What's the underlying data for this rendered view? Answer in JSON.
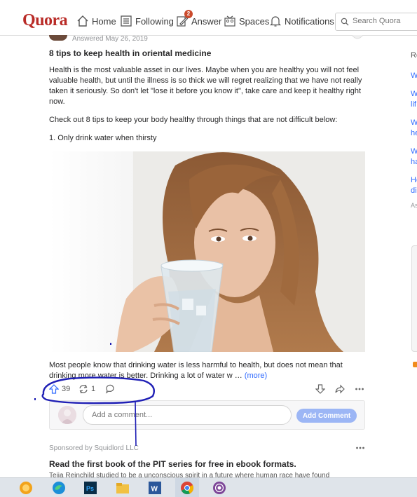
{
  "header": {
    "logo": "Quora",
    "nav": {
      "home": "Home",
      "following": "Following",
      "answer": "Answer",
      "answer_badge": "2",
      "spaces": "Spaces",
      "notifications": "Notifications"
    },
    "search_placeholder": "Search Quora"
  },
  "post": {
    "answered_date": "Answered May 26, 2019",
    "title": "8 tips to keep health in oriental medicine",
    "paragraph1": "Health is the most valuable asset in our lives. Maybe when you are healthy you will not feel valuable health, but until the illness is so thick we will regret realizing that we have not really taken it seriously. So don't let \"lose it before you know it\", take care and keep it healthy right now.",
    "paragraph2": "Check out 8 tips to keep your body healthy through things that are not difficult below:",
    "list_item1": "1. Only drink water when thirsty",
    "paragraph3": "Most people know that drinking water is less harmful to health, but does not mean that drinking more water is better. Drinking a lot of water w …",
    "more_link": "(more)",
    "upvotes": "39",
    "shares": "1"
  },
  "comment": {
    "placeholder": "Add a comment...",
    "button": "Add Comment"
  },
  "ad": {
    "sponsored": "Sponsored by Squidlord LLC",
    "title": "Read the first book of the PIT series for free in ebook formats.",
    "subtitle": "Teija Reinchild studied to be a unconscious spirit in a future where human race have found"
  },
  "right_sidebar": {
    "heading_fragment": "Re",
    "items": [
      "W",
      "W",
      "lif",
      "W",
      "he",
      "W",
      "ha",
      "He",
      "di",
      "As"
    ]
  },
  "colors": {
    "brand": "#b92b27",
    "link": "#2e69ff",
    "annotation_ink": "#1f1fb5",
    "comment_button": "#9cb6f5"
  }
}
